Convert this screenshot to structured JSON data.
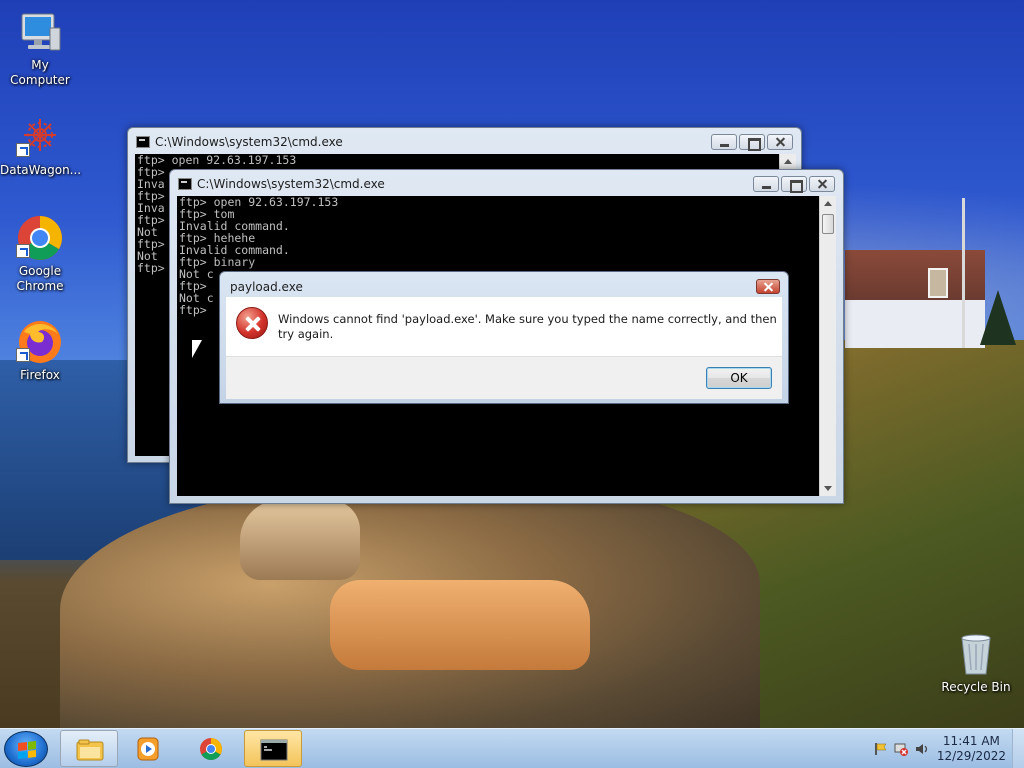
{
  "desktop": {
    "icons": [
      {
        "label": "My Computer"
      },
      {
        "label": "DataWagon..."
      },
      {
        "label": "Google Chrome"
      },
      {
        "label": "Firefox"
      },
      {
        "label": "Recycle Bin"
      }
    ]
  },
  "cmd_back": {
    "title": "C:\\Windows\\system32\\cmd.exe",
    "lines": [
      "ftp> open 92.63.197.153",
      "ftp>",
      "Inva",
      "ftp>",
      "Inva",
      "ftp>",
      "Not",
      "ftp>",
      "Not",
      "ftp>"
    ]
  },
  "cmd_front": {
    "title": "C:\\Windows\\system32\\cmd.exe",
    "lines": [
      "ftp> open 92.63.197.153",
      "ftp> tom",
      "Invalid command.",
      "ftp> hehehe",
      "Invalid command.",
      "ftp> binary",
      "Not c",
      "ftp>",
      "Not c",
      "ftp>"
    ]
  },
  "dialog": {
    "title": "payload.exe",
    "message": "Windows cannot find 'payload.exe'. Make sure you typed the name correctly, and then try again.",
    "ok_label": "OK"
  },
  "taskbar": {
    "buttons": [
      "file-explorer-icon",
      "media-player-icon",
      "chrome-icon",
      "cmd-icon"
    ],
    "clock_time": "11:41 AM",
    "clock_date": "12/29/2022"
  },
  "colors": {
    "console_bg": "#000000",
    "console_text": "#c0c0c0",
    "error_red": "#d2322a",
    "accent_blue": "#1f6fd0"
  }
}
